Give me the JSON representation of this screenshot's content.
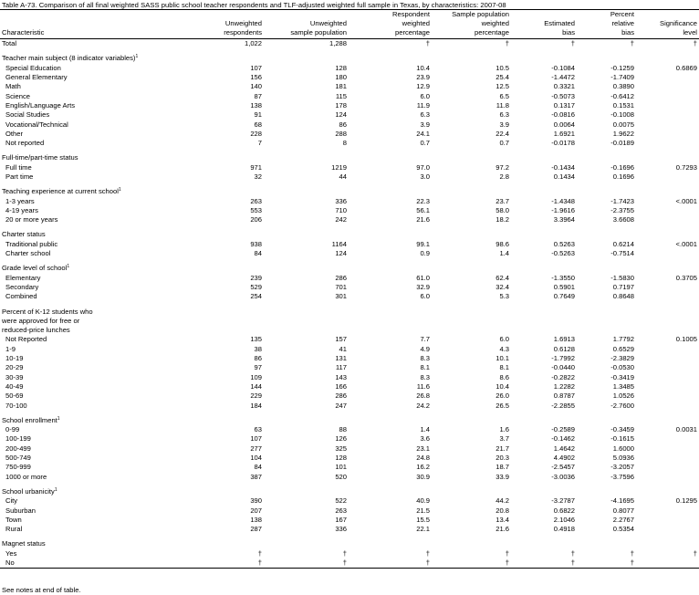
{
  "title": "Table A-73. Comparison of all final weighted SASS public school teacher respondents and TLF-adjusted weighted full sample in Texas, by characteristics: 2007-08",
  "columns": {
    "characteristic": "Characteristic",
    "unweighted_respondents": [
      "Unweighted",
      "respondents"
    ],
    "unweighted_sample": [
      "Unweighted",
      "sample population"
    ],
    "respondent_weighted_pct": [
      "Respondent",
      "weighted",
      "percentage"
    ],
    "sample_weighted_pct": [
      "Sample population",
      "weighted",
      "percentage"
    ],
    "estimated_bias": [
      "Estimated",
      "bias"
    ],
    "percent_relative_bias": [
      "Percent",
      "relative",
      "bias"
    ],
    "significance_level": [
      "Significance",
      "level"
    ]
  },
  "rows": [
    {
      "kind": "data",
      "label": "Total",
      "sup": "",
      "cells": [
        "1,022",
        "1,288",
        "†",
        "†",
        "†",
        "†",
        "†"
      ]
    },
    {
      "kind": "spacer"
    },
    {
      "kind": "header",
      "label": "Teacher main subject (8 indicator variables)",
      "sup": "1"
    },
    {
      "kind": "cat",
      "label": "Special Education",
      "cells": [
        "107",
        "128",
        "10.4",
        "10.5",
        "-0.1084",
        "-0.1259",
        "0.6869"
      ]
    },
    {
      "kind": "cat",
      "label": "General Elementary",
      "cells": [
        "156",
        "180",
        "23.9",
        "25.4",
        "-1.4472",
        "-1.7409",
        ""
      ]
    },
    {
      "kind": "cat",
      "label": "Math",
      "cells": [
        "140",
        "181",
        "12.9",
        "12.5",
        "0.3321",
        "0.3890",
        ""
      ]
    },
    {
      "kind": "cat",
      "label": "Science",
      "cells": [
        "87",
        "115",
        "6.0",
        "6.5",
        "-0.5073",
        "-0.6412",
        ""
      ]
    },
    {
      "kind": "cat",
      "label": "English/Language Arts",
      "cells": [
        "138",
        "178",
        "11.9",
        "11.8",
        "0.1317",
        "0.1531",
        ""
      ]
    },
    {
      "kind": "cat",
      "label": "Social Studies",
      "cells": [
        "91",
        "124",
        "6.3",
        "6.3",
        "-0.0816",
        "-0.1008",
        ""
      ]
    },
    {
      "kind": "cat",
      "label": "Vocational/Technical",
      "cells": [
        "68",
        "86",
        "3.9",
        "3.9",
        "0.0064",
        "0.0075",
        ""
      ]
    },
    {
      "kind": "cat",
      "label": "Other",
      "cells": [
        "228",
        "288",
        "24.1",
        "22.4",
        "1.6921",
        "1.9622",
        ""
      ]
    },
    {
      "kind": "cat",
      "label": "Not reported",
      "cells": [
        "7",
        "8",
        "0.7",
        "0.7",
        "-0.0178",
        "-0.0189",
        ""
      ]
    },
    {
      "kind": "spacer"
    },
    {
      "kind": "header",
      "label": "Full-time/part-time status",
      "sup": ""
    },
    {
      "kind": "cat",
      "label": "Full time",
      "cells": [
        "971",
        "1219",
        "97.0",
        "97.2",
        "-0.1434",
        "-0.1696",
        "0.7293"
      ]
    },
    {
      "kind": "cat",
      "label": "Part time",
      "cells": [
        "32",
        "44",
        "3.0",
        "2.8",
        "0.1434",
        "0.1696",
        ""
      ]
    },
    {
      "kind": "spacer"
    },
    {
      "kind": "header",
      "label": "Teaching experience at current school",
      "sup": "1"
    },
    {
      "kind": "cat",
      "label": "1-3 years",
      "cells": [
        "263",
        "336",
        "22.3",
        "23.7",
        "-1.4348",
        "-1.7423",
        "<.0001"
      ]
    },
    {
      "kind": "cat",
      "label": "4-19 years",
      "cells": [
        "553",
        "710",
        "56.1",
        "58.0",
        "-1.9616",
        "-2.3755",
        ""
      ]
    },
    {
      "kind": "cat",
      "label": "20 or more years",
      "cells": [
        "206",
        "242",
        "21.6",
        "18.2",
        "3.3964",
        "3.6608",
        ""
      ]
    },
    {
      "kind": "spacer"
    },
    {
      "kind": "header",
      "label": "Charter status",
      "sup": ""
    },
    {
      "kind": "cat",
      "label": "Traditional public",
      "cells": [
        "938",
        "1164",
        "99.1",
        "98.6",
        "0.5263",
        "0.6214",
        "<.0001"
      ]
    },
    {
      "kind": "cat",
      "label": "Charter school",
      "cells": [
        "84",
        "124",
        "0.9",
        "1.4",
        "-0.5263",
        "-0.7514",
        ""
      ]
    },
    {
      "kind": "spacer"
    },
    {
      "kind": "header",
      "label": "Grade level of school",
      "sup": "1"
    },
    {
      "kind": "cat",
      "label": "Elementary",
      "cells": [
        "239",
        "286",
        "61.0",
        "62.4",
        "-1.3550",
        "-1.5830",
        "0.3705"
      ]
    },
    {
      "kind": "cat",
      "label": "Secondary",
      "cells": [
        "529",
        "701",
        "32.9",
        "32.4",
        "0.5901",
        "0.7197",
        ""
      ]
    },
    {
      "kind": "cat",
      "label": "Combined",
      "cells": [
        "254",
        "301",
        "6.0",
        "5.3",
        "0.7649",
        "0.8648",
        ""
      ]
    },
    {
      "kind": "spacer"
    },
    {
      "kind": "header",
      "label": "Percent of K-12 students who",
      "sup": ""
    },
    {
      "kind": "header2",
      "label": "were approved for free or",
      "sup": ""
    },
    {
      "kind": "header2",
      "label": "reduced-price lunches",
      "sup": ""
    },
    {
      "kind": "cat",
      "label": "Not Reported",
      "cells": [
        "135",
        "157",
        "7.7",
        "6.0",
        "1.6913",
        "1.7792",
        "0.1005"
      ]
    },
    {
      "kind": "cat",
      "label": "1-9",
      "cells": [
        "38",
        "41",
        "4.9",
        "4.3",
        "0.6128",
        "0.6529",
        ""
      ]
    },
    {
      "kind": "cat",
      "label": "10-19",
      "cells": [
        "86",
        "131",
        "8.3",
        "10.1",
        "-1.7992",
        "-2.3829",
        ""
      ]
    },
    {
      "kind": "cat",
      "label": "20-29",
      "cells": [
        "97",
        "117",
        "8.1",
        "8.1",
        "-0.0440",
        "-0.0530",
        ""
      ]
    },
    {
      "kind": "cat",
      "label": "30-39",
      "cells": [
        "109",
        "143",
        "8.3",
        "8.6",
        "-0.2822",
        "-0.3419",
        ""
      ]
    },
    {
      "kind": "cat",
      "label": "40-49",
      "cells": [
        "144",
        "166",
        "11.6",
        "10.4",
        "1.2282",
        "1.3485",
        ""
      ]
    },
    {
      "kind": "cat",
      "label": "50-69",
      "cells": [
        "229",
        "286",
        "26.8",
        "26.0",
        "0.8787",
        "1.0526",
        ""
      ]
    },
    {
      "kind": "cat",
      "label": "70-100",
      "cells": [
        "184",
        "247",
        "24.2",
        "26.5",
        "-2.2855",
        "-2.7600",
        ""
      ]
    },
    {
      "kind": "spacer"
    },
    {
      "kind": "header",
      "label": "School enrollment",
      "sup": "1"
    },
    {
      "kind": "cat",
      "label": "0-99",
      "cells": [
        "63",
        "88",
        "1.4",
        "1.6",
        "-0.2589",
        "-0.3459",
        "0.0031"
      ]
    },
    {
      "kind": "cat",
      "label": "100-199",
      "cells": [
        "107",
        "126",
        "3.6",
        "3.7",
        "-0.1462",
        "-0.1615",
        ""
      ]
    },
    {
      "kind": "cat",
      "label": "200-499",
      "cells": [
        "277",
        "325",
        "23.1",
        "21.7",
        "1.4642",
        "1.6000",
        ""
      ]
    },
    {
      "kind": "cat",
      "label": "500-749",
      "cells": [
        "104",
        "128",
        "24.8",
        "20.3",
        "4.4902",
        "5.0936",
        ""
      ]
    },
    {
      "kind": "cat",
      "label": "750-999",
      "cells": [
        "84",
        "101",
        "16.2",
        "18.7",
        "-2.5457",
        "-3.2057",
        ""
      ]
    },
    {
      "kind": "cat",
      "label": "1000 or more",
      "cells": [
        "387",
        "520",
        "30.9",
        "33.9",
        "-3.0036",
        "-3.7596",
        ""
      ]
    },
    {
      "kind": "spacer"
    },
    {
      "kind": "header",
      "label": "School urbanicity",
      "sup": "1"
    },
    {
      "kind": "cat",
      "label": "City",
      "cells": [
        "390",
        "522",
        "40.9",
        "44.2",
        "-3.2787",
        "-4.1695",
        "0.1295"
      ]
    },
    {
      "kind": "cat",
      "label": "Suburban",
      "cells": [
        "207",
        "263",
        "21.5",
        "20.8",
        "0.6822",
        "0.8077",
        ""
      ]
    },
    {
      "kind": "cat",
      "label": "Town",
      "cells": [
        "138",
        "167",
        "15.5",
        "13.4",
        "2.1046",
        "2.2767",
        ""
      ]
    },
    {
      "kind": "cat",
      "label": "Rural",
      "cells": [
        "287",
        "336",
        "22.1",
        "21.6",
        "0.4918",
        "0.5354",
        ""
      ]
    },
    {
      "kind": "spacer"
    },
    {
      "kind": "header",
      "label": "Magnet status",
      "sup": ""
    },
    {
      "kind": "cat",
      "label": "Yes",
      "cells": [
        "†",
        "†",
        "†",
        "†",
        "†",
        "†",
        "†"
      ]
    },
    {
      "kind": "cat",
      "label": "No",
      "cells": [
        "†",
        "†",
        "†",
        "†",
        "†",
        "†",
        ""
      ],
      "last": true
    }
  ],
  "note": "See notes at end of table."
}
